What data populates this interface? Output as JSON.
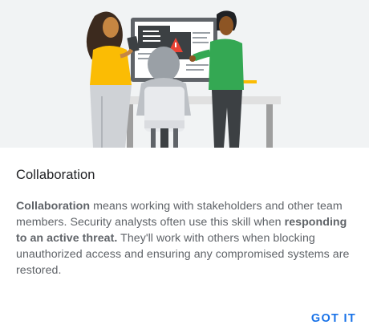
{
  "dialog": {
    "title": "Collaboration",
    "body": {
      "term": "Collaboration",
      "part1": " means working with stakeholders and other team members. Security analysts often use this skill when ",
      "highlight": "responding to an active threat.",
      "part2": " They'll work with others when blocking unauthorized access and ensuring any compromised systems are restored."
    },
    "action_label": "GOT IT",
    "colors": {
      "accent": "#1a73e8",
      "hero_background": "#f1f3f4",
      "person_left_shirt": "#fbbc04",
      "person_right_shirt": "#34a853",
      "alert": "#ea4335"
    },
    "illustration": "team-collaboration-illustration"
  }
}
